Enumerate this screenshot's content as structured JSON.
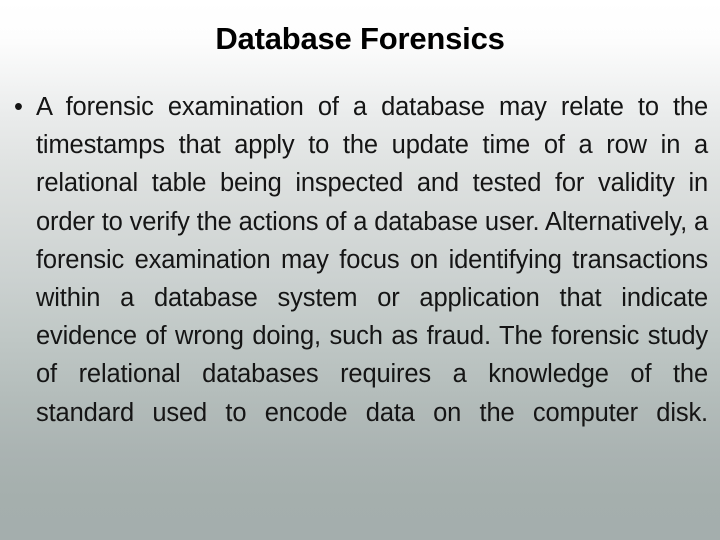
{
  "slide": {
    "title": "Database Forensics",
    "background": {
      "type": "linear-gradient-vertical",
      "from_color": "#ffffff",
      "to_color": "#a4aead"
    },
    "text_color": "#151515",
    "bullets": [
      {
        "marker": "•",
        "text": "A forensic examination of a database may relate to the timestamps that apply to the update time of a row in a relational table being inspected and tested for validity in order to verify the actions of a database user. Alternatively, a forensic examination may focus on identifying transactions within a database system or application that indicate evidence of wrong doing, such as fraud. The forensic study of relational databases requires a knowledge of the standard used to encode data on the computer disk."
      }
    ]
  }
}
